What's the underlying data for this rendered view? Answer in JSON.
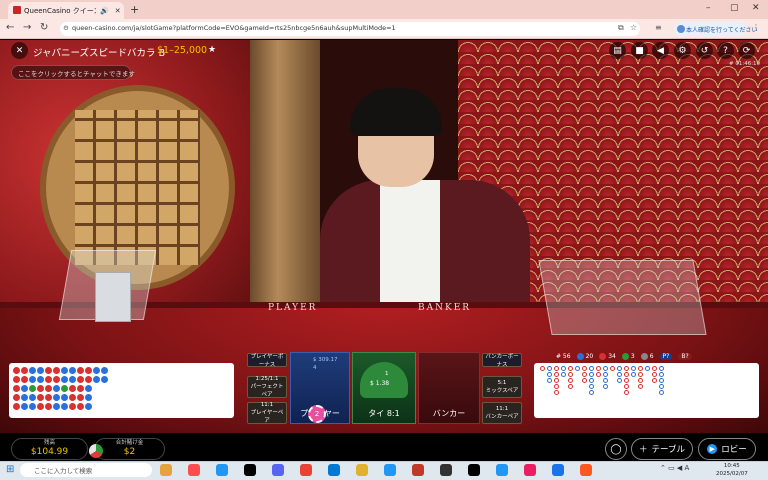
{
  "browser": {
    "tab_title": "QueenCasino クイーンカジノ | ",
    "url": "queen-casino.com/ja/slotGame?platformCode=EVO&gameId=rts25nbcge5n6auh&supMultiMode=1",
    "profile_label": "本人確認を行ってください"
  },
  "game": {
    "title": "ジャパニーズスピードバカラ B",
    "limits": "$1–25,000",
    "chat_placeholder": "ここをクリックするとチャットできます",
    "game_id": "# 01:46:10",
    "table_player": "PLAYER",
    "table_banker": "BANKER"
  },
  "stats": {
    "total": "# 56",
    "player": "20",
    "banker": "34",
    "tie": "3",
    "pairs": "6",
    "p_label": "P?",
    "b_label": "B?",
    "colors": {
      "player": "#2a6fdb",
      "banker": "#d93030",
      "tie": "#2a9a3a"
    }
  },
  "bets": {
    "player_bonus": "プレイヤーボーナス",
    "banker_bonus": "バンカーボーナス",
    "perfect_pair_odds": "1:25/1:1",
    "perfect_pair": "パーフェクトペア",
    "either_pair_odds": "5:1",
    "either_pair": "ミックスペア",
    "player_pair_odds": "11:1",
    "player_pair": "プレイヤーペア",
    "banker_pair_odds": "11:1",
    "banker_pair": "バンカーペア",
    "player": "プレイヤー",
    "player_total": "$ 309.17",
    "player_count": "4",
    "tie": "タイ 8:1",
    "tie_total": "$ 1.38",
    "tie_count": "1",
    "banker": "バンカー",
    "chip_value": "2"
  },
  "footer": {
    "balance_label": "残高",
    "balance": "$104.99",
    "total_bet_label": "合計賭け金",
    "total_bet": "$2",
    "table_button": "テーブル",
    "lobby_button": "ロビー"
  },
  "taskbar": {
    "search_placeholder": "ここに入力して検索",
    "time": "10:45",
    "date": "2025/02/07",
    "ime": "A"
  }
}
